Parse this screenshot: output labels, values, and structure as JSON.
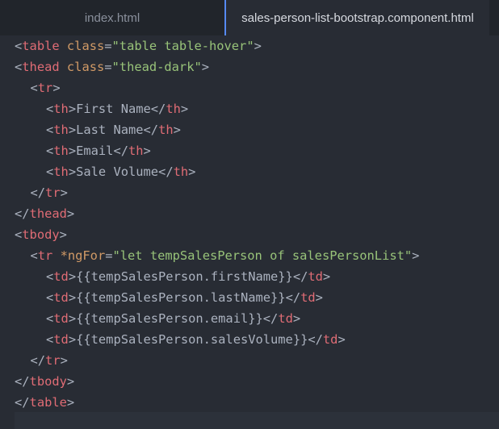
{
  "tabs": [
    {
      "label": "index.html",
      "active": false
    },
    {
      "label": "sales-person-list-bootstrap.component.html",
      "active": true
    }
  ],
  "code": {
    "lines": [
      {
        "indent": 0,
        "tokens": [
          {
            "t": "tagp",
            "v": "<"
          },
          {
            "t": "tagn",
            "v": "table"
          },
          {
            "t": "txt",
            "v": " "
          },
          {
            "t": "attr",
            "v": "class"
          },
          {
            "t": "txt",
            "v": "="
          },
          {
            "t": "str",
            "v": "\"table table-hover\""
          },
          {
            "t": "tagp",
            "v": ">"
          }
        ]
      },
      {
        "indent": 0,
        "tokens": [
          {
            "t": "tagp",
            "v": "<"
          },
          {
            "t": "tagn",
            "v": "thead"
          },
          {
            "t": "txt",
            "v": " "
          },
          {
            "t": "attr",
            "v": "class"
          },
          {
            "t": "txt",
            "v": "="
          },
          {
            "t": "str",
            "v": "\"thead-dark\""
          },
          {
            "t": "tagp",
            "v": ">"
          }
        ]
      },
      {
        "indent": 1,
        "tokens": [
          {
            "t": "tagp",
            "v": "<"
          },
          {
            "t": "tagn",
            "v": "tr"
          },
          {
            "t": "tagp",
            "v": ">"
          }
        ]
      },
      {
        "indent": 2,
        "tokens": [
          {
            "t": "tagp",
            "v": "<"
          },
          {
            "t": "tagn",
            "v": "th"
          },
          {
            "t": "tagp",
            "v": ">"
          },
          {
            "t": "txt",
            "v": "First Name"
          },
          {
            "t": "tagp",
            "v": "</"
          },
          {
            "t": "tagn",
            "v": "th"
          },
          {
            "t": "tagp",
            "v": ">"
          }
        ]
      },
      {
        "indent": 2,
        "tokens": [
          {
            "t": "tagp",
            "v": "<"
          },
          {
            "t": "tagn",
            "v": "th"
          },
          {
            "t": "tagp",
            "v": ">"
          },
          {
            "t": "txt",
            "v": "Last Name"
          },
          {
            "t": "tagp",
            "v": "</"
          },
          {
            "t": "tagn",
            "v": "th"
          },
          {
            "t": "tagp",
            "v": ">"
          }
        ]
      },
      {
        "indent": 2,
        "tokens": [
          {
            "t": "tagp",
            "v": "<"
          },
          {
            "t": "tagn",
            "v": "th"
          },
          {
            "t": "tagp",
            "v": ">"
          },
          {
            "t": "txt",
            "v": "Email"
          },
          {
            "t": "tagp",
            "v": "</"
          },
          {
            "t": "tagn",
            "v": "th"
          },
          {
            "t": "tagp",
            "v": ">"
          }
        ]
      },
      {
        "indent": 2,
        "tokens": [
          {
            "t": "tagp",
            "v": "<"
          },
          {
            "t": "tagn",
            "v": "th"
          },
          {
            "t": "tagp",
            "v": ">"
          },
          {
            "t": "txt",
            "v": "Sale Volume"
          },
          {
            "t": "tagp",
            "v": "</"
          },
          {
            "t": "tagn",
            "v": "th"
          },
          {
            "t": "tagp",
            "v": ">"
          }
        ]
      },
      {
        "indent": 1,
        "tokens": [
          {
            "t": "tagp",
            "v": "</"
          },
          {
            "t": "tagn",
            "v": "tr"
          },
          {
            "t": "tagp",
            "v": ">"
          }
        ]
      },
      {
        "indent": 0,
        "tokens": [
          {
            "t": "tagp",
            "v": "</"
          },
          {
            "t": "tagn",
            "v": "thead"
          },
          {
            "t": "tagp",
            "v": ">"
          }
        ]
      },
      {
        "indent": 0,
        "tokens": [
          {
            "t": "tagp",
            "v": "<"
          },
          {
            "t": "tagn",
            "v": "tbody"
          },
          {
            "t": "tagp",
            "v": ">"
          }
        ]
      },
      {
        "indent": 1,
        "tokens": [
          {
            "t": "tagp",
            "v": "<"
          },
          {
            "t": "tagn",
            "v": "tr"
          },
          {
            "t": "txt",
            "v": " "
          },
          {
            "t": "attr",
            "v": "*ngFor"
          },
          {
            "t": "txt",
            "v": "="
          },
          {
            "t": "str",
            "v": "\"let tempSalesPerson of salesPersonList\""
          },
          {
            "t": "tagp",
            "v": ">"
          }
        ]
      },
      {
        "indent": 2,
        "tokens": [
          {
            "t": "tagp",
            "v": "<"
          },
          {
            "t": "tagn",
            "v": "td"
          },
          {
            "t": "tagp",
            "v": ">"
          },
          {
            "t": "txt",
            "v": "{{tempSalesPerson.firstName}}"
          },
          {
            "t": "tagp",
            "v": "</"
          },
          {
            "t": "tagn",
            "v": "td"
          },
          {
            "t": "tagp",
            "v": ">"
          }
        ]
      },
      {
        "indent": 2,
        "tokens": [
          {
            "t": "tagp",
            "v": "<"
          },
          {
            "t": "tagn",
            "v": "td"
          },
          {
            "t": "tagp",
            "v": ">"
          },
          {
            "t": "txt",
            "v": "{{tempSalesPerson.lastName}}"
          },
          {
            "t": "tagp",
            "v": "</"
          },
          {
            "t": "tagn",
            "v": "td"
          },
          {
            "t": "tagp",
            "v": ">"
          }
        ]
      },
      {
        "indent": 2,
        "tokens": [
          {
            "t": "tagp",
            "v": "<"
          },
          {
            "t": "tagn",
            "v": "td"
          },
          {
            "t": "tagp",
            "v": ">"
          },
          {
            "t": "txt",
            "v": "{{tempSalesPerson.email}}"
          },
          {
            "t": "tagp",
            "v": "</"
          },
          {
            "t": "tagn",
            "v": "td"
          },
          {
            "t": "tagp",
            "v": ">"
          }
        ]
      },
      {
        "indent": 2,
        "tokens": [
          {
            "t": "tagp",
            "v": "<"
          },
          {
            "t": "tagn",
            "v": "td"
          },
          {
            "t": "tagp",
            "v": ">"
          },
          {
            "t": "txt",
            "v": "{{tempSalesPerson.salesVolume}}"
          },
          {
            "t": "tagp",
            "v": "</"
          },
          {
            "t": "tagn",
            "v": "td"
          },
          {
            "t": "tagp",
            "v": ">"
          }
        ]
      },
      {
        "indent": 1,
        "tokens": [
          {
            "t": "tagp",
            "v": "</"
          },
          {
            "t": "tagn",
            "v": "tr"
          },
          {
            "t": "tagp",
            "v": ">"
          }
        ]
      },
      {
        "indent": 0,
        "tokens": [
          {
            "t": "tagp",
            "v": "</"
          },
          {
            "t": "tagn",
            "v": "tbody"
          },
          {
            "t": "tagp",
            "v": ">"
          }
        ]
      },
      {
        "indent": 0,
        "tokens": [
          {
            "t": "tagp",
            "v": "</"
          },
          {
            "t": "tagn",
            "v": "table"
          },
          {
            "t": "tagp",
            "v": ">"
          }
        ]
      }
    ]
  },
  "colors": {
    "editor_background": "#282c34",
    "tabbar_background": "#21252b",
    "active_tab_accent": "#568af2",
    "tag_name": "#e06c75",
    "attribute": "#d19a66",
    "string": "#98c379",
    "text": "#abb2bf"
  }
}
